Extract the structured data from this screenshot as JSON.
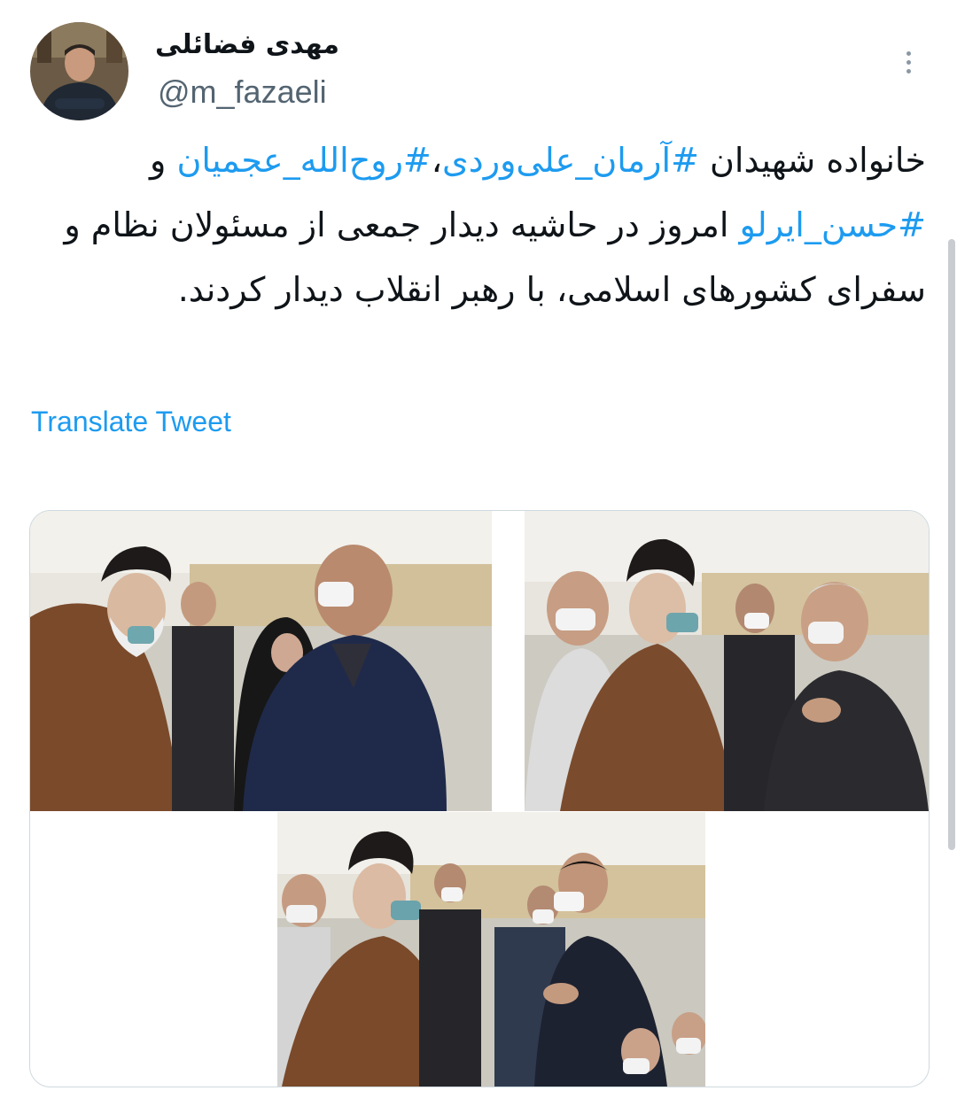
{
  "author": {
    "display_name": "مهدی فضائلی",
    "handle": "@m_fazaeli"
  },
  "tweet": {
    "prefix": "خانواده شهیدان ",
    "hashtag_1": "#آرمان_علی‌وردی",
    "sep": "،",
    "hashtag_2": "#روح‌الله_عجمیان",
    "conj": " و ",
    "hashtag_3": "#حسن_ایرلو",
    "body": " امروز در حاشیه دیدار جمعی از مسئولان نظام و سفرای کشورهای اسلامی، با رهبر انقلاب دیدار کردند."
  },
  "translate_label": "Translate Tweet",
  "colors": {
    "link": "#1d9bf0",
    "secondary_text": "#536471",
    "border": "#cfd9de"
  },
  "icons": {
    "more": "more-vertical-icon"
  }
}
